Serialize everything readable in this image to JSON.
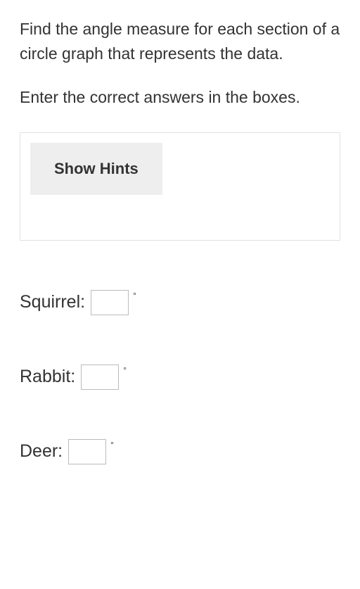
{
  "question": "Find the angle measure for each section of a circle graph that represents the data.",
  "instruction": "Enter the correct answers in the boxes.",
  "hints": {
    "button_label": "Show Hints"
  },
  "answers": [
    {
      "label": "Squirrel:",
      "value": "",
      "unit": "°"
    },
    {
      "label": "Rabbit:",
      "value": "",
      "unit": "°"
    },
    {
      "label": "Deer:",
      "value": "",
      "unit": "°"
    }
  ]
}
